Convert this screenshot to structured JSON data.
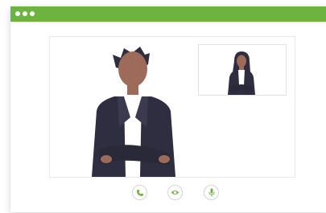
{
  "window": {
    "titlebar_color": "#6db33f",
    "titlebar_dots": [
      "window-dot",
      "window-dot",
      "window-dot"
    ]
  },
  "video_call": {
    "main_participant": "man-in-suit-avatar",
    "pip_participant": "woman-in-suit-avatar",
    "accent_color": "#6db33f",
    "skin_color": "#9e6a5a",
    "suit_color": "#2f2e41"
  },
  "controls": [
    {
      "name": "call-button",
      "icon": "phone-icon"
    },
    {
      "name": "video-toggle-button",
      "icon": "eye-icon"
    },
    {
      "name": "mute-button",
      "icon": "microphone-icon"
    }
  ]
}
